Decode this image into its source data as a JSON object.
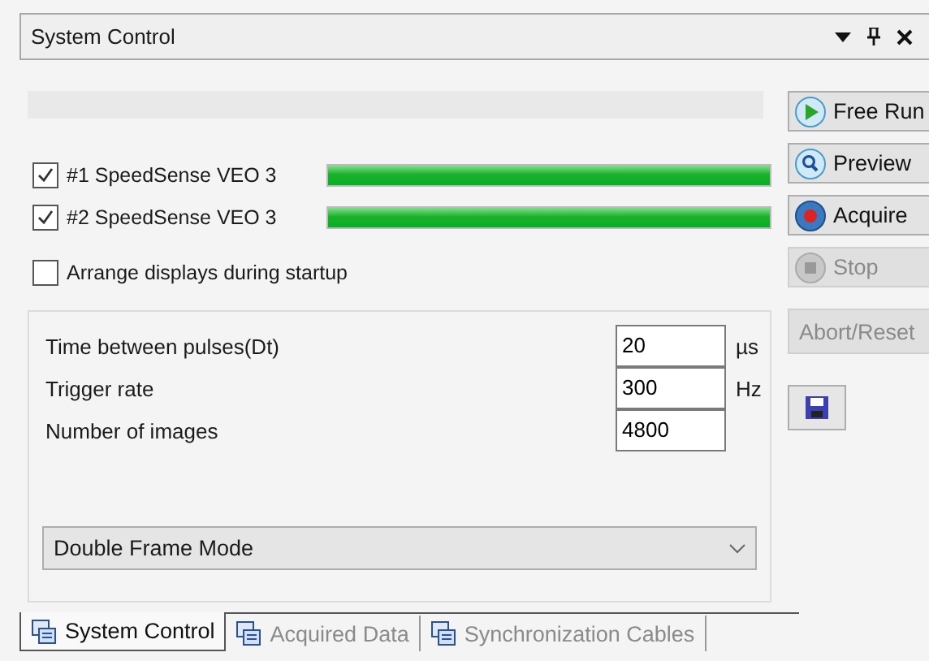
{
  "panel": {
    "title": "System Control"
  },
  "cameras": [
    {
      "label": "#1 SpeedSense VEO 3",
      "checked": true,
      "level": 1.0
    },
    {
      "label": "#2 SpeedSense VEO 3",
      "checked": true,
      "level": 1.0
    }
  ],
  "arrange_option": {
    "label": "Arrange displays during startup",
    "checked": false
  },
  "parameters": [
    {
      "label": "Time between pulses(Dt)",
      "value": "20",
      "unit": "µs"
    },
    {
      "label": "Trigger rate",
      "value": "300",
      "unit": "Hz"
    },
    {
      "label": "Number of images",
      "value": "4800"
    }
  ],
  "mode_select": {
    "value": "Double Frame Mode"
  },
  "actions": [
    {
      "kind": "free-run",
      "label": "Free Run",
      "disabled": false
    },
    {
      "kind": "preview",
      "label": "Preview",
      "disabled": false
    },
    {
      "kind": "acquire",
      "label": "Acquire",
      "disabled": false
    },
    {
      "kind": "stop",
      "label": "Stop",
      "disabled": true
    },
    {
      "kind": "text",
      "label": "Abort/Reset",
      "disabled": true
    },
    {
      "kind": "save",
      "disabled": false
    }
  ],
  "tabs": [
    {
      "label": "System Control",
      "selected": true
    },
    {
      "label": "Acquired Data",
      "selected": false
    },
    {
      "label": "Synchronization Cables",
      "selected": false
    }
  ]
}
